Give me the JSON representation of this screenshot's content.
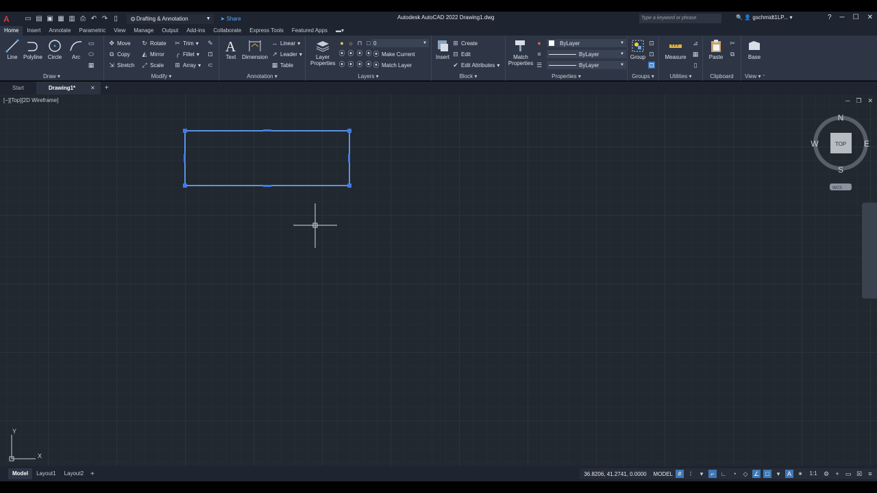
{
  "title_bar": {
    "workspace": "Drafting & Annotation",
    "share_label": "Share",
    "window_title": "Autodesk AutoCAD 2022   Drawing1.dwg",
    "search_placeholder": "Type a keyword or phrase",
    "user_name": "gschmidt1LP..."
  },
  "ribbon_tabs": [
    "Home",
    "Insert",
    "Annotate",
    "Parametric",
    "View",
    "Manage",
    "Output",
    "Add-ins",
    "Collaborate",
    "Express Tools",
    "Featured Apps"
  ],
  "ribbon": {
    "draw": {
      "title": "Draw",
      "line": "Line",
      "polyline": "Polyline",
      "circle": "Circle",
      "arc": "Arc"
    },
    "modify": {
      "title": "Modify",
      "move": "Move",
      "rotate": "Rotate",
      "trim": "Trim",
      "copy": "Copy",
      "mirror": "Mirror",
      "fillet": "Fillet",
      "stretch": "Stretch",
      "scale": "Scale",
      "array": "Array"
    },
    "annotation": {
      "title": "Annotation",
      "text": "Text",
      "dimension": "Dimension",
      "linear": "Linear",
      "leader": "Leader",
      "table": "Table"
    },
    "layers": {
      "title": "Layers",
      "layer_properties": "Layer Properties",
      "current_layer": "0",
      "make_current": "Make Current",
      "match_layer": "Match Layer"
    },
    "block": {
      "title": "Block",
      "insert": "Insert",
      "create": "Create",
      "edit": "Edit",
      "edit_attributes": "Edit Attributes"
    },
    "properties": {
      "title": "Properties",
      "match_properties": "Match Properties",
      "color": "ByLayer",
      "linetype": "ByLayer",
      "lineweight": "ByLayer"
    },
    "groups": {
      "title": "Groups",
      "group": "Group"
    },
    "utilities": {
      "title": "Utilities",
      "measure": "Measure"
    },
    "clipboard": {
      "title": "Clipboard",
      "paste": "Paste"
    },
    "view": {
      "title": "View",
      "base": "Base"
    }
  },
  "file_tabs": {
    "start": "Start",
    "drawing": "Drawing1*"
  },
  "viewport": {
    "label": "[−][Top][2D Wireframe]",
    "viewcube": {
      "face": "TOP",
      "north": "N",
      "south": "S",
      "east": "E",
      "west": "W",
      "wcs": "WCS"
    },
    "ucs": {
      "x": "X",
      "y": "Y"
    }
  },
  "layout_tabs": [
    "Model",
    "Layout1",
    "Layout2"
  ],
  "status_bar": {
    "coordinates": "36.8206, 41.2741, 0.0000",
    "model": "MODEL",
    "scale": "1:1"
  },
  "colors": {
    "canvas": "#212830",
    "selection": "#5a95e6",
    "grip": "#3f7ce8",
    "ribbon": "#2e3646",
    "titlebar": "#1e2430"
  }
}
